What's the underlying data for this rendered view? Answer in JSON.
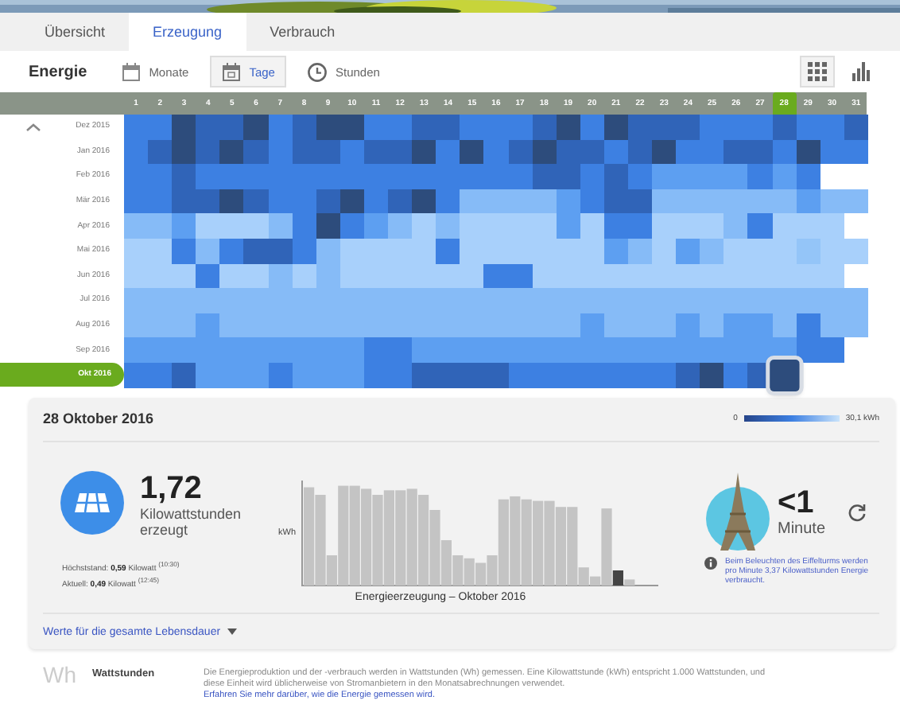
{
  "tabs": [
    {
      "label": "Übersicht",
      "selected": false
    },
    {
      "label": "Erzeugung",
      "selected": true
    },
    {
      "label": "Verbrauch",
      "selected": false
    }
  ],
  "toolbar": {
    "title": "Energie",
    "periods": [
      {
        "label": "Monate",
        "kind": "month",
        "selected": false
      },
      {
        "label": "Tage",
        "kind": "day",
        "selected": true
      },
      {
        "label": "Stunden",
        "kind": "hour",
        "selected": false
      }
    ],
    "views": [
      {
        "kind": "grid",
        "selected": true
      },
      {
        "kind": "bars",
        "selected": false
      }
    ]
  },
  "heatmap": {
    "days": [
      {
        "label": "1",
        "selected": false
      },
      {
        "label": "2",
        "selected": false
      },
      {
        "label": "3",
        "selected": false
      },
      {
        "label": "4",
        "selected": false
      },
      {
        "label": "5",
        "selected": false
      },
      {
        "label": "6",
        "selected": false
      },
      {
        "label": "7",
        "selected": false
      },
      {
        "label": "8",
        "selected": false
      },
      {
        "label": "9",
        "selected": false
      },
      {
        "label": "10",
        "selected": false
      },
      {
        "label": "11",
        "selected": false
      },
      {
        "label": "12",
        "selected": false
      },
      {
        "label": "13",
        "selected": false
      },
      {
        "label": "14",
        "selected": false
      },
      {
        "label": "15",
        "selected": false
      },
      {
        "label": "16",
        "selected": false
      },
      {
        "label": "17",
        "selected": false
      },
      {
        "label": "18",
        "selected": false
      },
      {
        "label": "19",
        "selected": false
      },
      {
        "label": "20",
        "selected": false
      },
      {
        "label": "21",
        "selected": false
      },
      {
        "label": "22",
        "selected": false
      },
      {
        "label": "23",
        "selected": false
      },
      {
        "label": "24",
        "selected": false
      },
      {
        "label": "25",
        "selected": false
      },
      {
        "label": "26",
        "selected": false
      },
      {
        "label": "27",
        "selected": false
      },
      {
        "label": "28",
        "selected": true
      },
      {
        "label": "29",
        "selected": false
      },
      {
        "label": "30",
        "selected": false
      },
      {
        "label": "31",
        "selected": false
      }
    ],
    "months": [
      {
        "label": "Dez 2015",
        "selected": false,
        "cells": [
          {
            "color": "#3d80e2"
          },
          {
            "color": "#3d80e2"
          },
          {
            "color": "#2d4c7c"
          },
          {
            "color": "#3064b8"
          },
          {
            "color": "#3064b8"
          },
          {
            "color": "#2d4c7c"
          },
          {
            "color": "#3d80e2"
          },
          {
            "color": "#3064b8"
          },
          {
            "color": "#2d4c7c"
          },
          {
            "color": "#2d4c7c"
          },
          {
            "color": "#3d80e2"
          },
          {
            "color": "#3d80e2"
          },
          {
            "color": "#3064b8"
          },
          {
            "color": "#3064b8"
          },
          {
            "color": "#3d80e2"
          },
          {
            "color": "#3d80e2"
          },
          {
            "color": "#3d80e2"
          },
          {
            "color": "#3064b8"
          },
          {
            "color": "#2d4c7c"
          },
          {
            "color": "#3d80e2"
          },
          {
            "color": "#2d4c7c"
          },
          {
            "color": "#3064b8"
          },
          {
            "color": "#3064b8"
          },
          {
            "color": "#3064b8"
          },
          {
            "color": "#3d80e2"
          },
          {
            "color": "#3d80e2"
          },
          {
            "color": "#3d80e2"
          },
          {
            "color": "#3064b8"
          },
          {
            "color": "#3d80e2"
          },
          {
            "color": "#3d80e2"
          },
          {
            "color": "#3064b8"
          }
        ]
      },
      {
        "label": "Jan 2016",
        "selected": false,
        "cells": [
          {
            "color": "#3d80e2"
          },
          {
            "color": "#3064b8"
          },
          {
            "color": "#2d4c7c"
          },
          {
            "color": "#3064b8"
          },
          {
            "color": "#2d4c7c"
          },
          {
            "color": "#3064b8"
          },
          {
            "color": "#3d80e2"
          },
          {
            "color": "#3064b8"
          },
          {
            "color": "#3064b8"
          },
          {
            "color": "#3d80e2"
          },
          {
            "color": "#3064b8"
          },
          {
            "color": "#3064b8"
          },
          {
            "color": "#2d4c7c"
          },
          {
            "color": "#3d80e2"
          },
          {
            "color": "#2d4c7c"
          },
          {
            "color": "#3d80e2"
          },
          {
            "color": "#3064b8"
          },
          {
            "color": "#2d4c7c"
          },
          {
            "color": "#3064b8"
          },
          {
            "color": "#3064b8"
          },
          {
            "color": "#3d80e2"
          },
          {
            "color": "#3064b8"
          },
          {
            "color": "#2d4c7c"
          },
          {
            "color": "#3d80e2"
          },
          {
            "color": "#3d80e2"
          },
          {
            "color": "#3064b8"
          },
          {
            "color": "#3064b8"
          },
          {
            "color": "#3d80e2"
          },
          {
            "color": "#2d4c7c"
          },
          {
            "color": "#3d80e2"
          },
          {
            "color": "#3d80e2"
          }
        ]
      },
      {
        "label": "Feb 2016",
        "selected": false,
        "cells": [
          {
            "color": "#3d80e2"
          },
          {
            "color": "#3d80e2"
          },
          {
            "color": "#3064b8"
          },
          {
            "color": "#3d80e2"
          },
          {
            "color": "#3d80e2"
          },
          {
            "color": "#3d80e2"
          },
          {
            "color": "#3d80e2"
          },
          {
            "color": "#3d80e2"
          },
          {
            "color": "#3d80e2"
          },
          {
            "color": "#3d80e2"
          },
          {
            "color": "#3d80e2"
          },
          {
            "color": "#3d80e2"
          },
          {
            "color": "#3d80e2"
          },
          {
            "color": "#3d80e2"
          },
          {
            "color": "#3d80e2"
          },
          {
            "color": "#3d80e2"
          },
          {
            "color": "#3d80e2"
          },
          {
            "color": "#3064b8"
          },
          {
            "color": "#3064b8"
          },
          {
            "color": "#3d80e2"
          },
          {
            "color": "#3064b8"
          },
          {
            "color": "#3d80e2"
          },
          {
            "color": "#5d9ff1"
          },
          {
            "color": "#5d9ff1"
          },
          {
            "color": "#5d9ff1"
          },
          {
            "color": "#5d9ff1"
          },
          {
            "color": "#3d80e2"
          },
          {
            "color": "#5d9ff1"
          },
          {
            "color": "#3d80e2"
          }
        ]
      },
      {
        "label": "Mär 2016",
        "selected": false,
        "cells": [
          {
            "color": "#3d80e2"
          },
          {
            "color": "#3d80e2"
          },
          {
            "color": "#3064b8"
          },
          {
            "color": "#3064b8"
          },
          {
            "color": "#2d4c7c"
          },
          {
            "color": "#3064b8"
          },
          {
            "color": "#3d80e2"
          },
          {
            "color": "#3d80e2"
          },
          {
            "color": "#3064b8"
          },
          {
            "color": "#2d4c7c"
          },
          {
            "color": "#3d80e2"
          },
          {
            "color": "#3064b8"
          },
          {
            "color": "#2d4c7c"
          },
          {
            "color": "#3d80e2"
          },
          {
            "color": "#86bbf7"
          },
          {
            "color": "#86bbf7"
          },
          {
            "color": "#86bbf7"
          },
          {
            "color": "#86bbf7"
          },
          {
            "color": "#5d9ff1"
          },
          {
            "color": "#3d80e2"
          },
          {
            "color": "#3064b8"
          },
          {
            "color": "#3064b8"
          },
          {
            "color": "#86bbf7"
          },
          {
            "color": "#86bbf7"
          },
          {
            "color": "#86bbf7"
          },
          {
            "color": "#86bbf7"
          },
          {
            "color": "#86bbf7"
          },
          {
            "color": "#86bbf7"
          },
          {
            "color": "#5d9ff1"
          },
          {
            "color": "#86bbf7"
          },
          {
            "color": "#86bbf7"
          }
        ]
      },
      {
        "label": "Apr 2016",
        "selected": false,
        "cells": [
          {
            "color": "#86bbf7"
          },
          {
            "color": "#86bbf7"
          },
          {
            "color": "#5d9ff1"
          },
          {
            "color": "#a8d0fb"
          },
          {
            "color": "#a8d0fb"
          },
          {
            "color": "#a8d0fb"
          },
          {
            "color": "#86bbf7"
          },
          {
            "color": "#3d80e2"
          },
          {
            "color": "#2d4c7c"
          },
          {
            "color": "#3d80e2"
          },
          {
            "color": "#5d9ff1"
          },
          {
            "color": "#86bbf7"
          },
          {
            "color": "#a8d0fb"
          },
          {
            "color": "#86bbf7"
          },
          {
            "color": "#a8d0fb"
          },
          {
            "color": "#a8d0fb"
          },
          {
            "color": "#a8d0fb"
          },
          {
            "color": "#a8d0fb"
          },
          {
            "color": "#5d9ff1"
          },
          {
            "color": "#a8d0fb"
          },
          {
            "color": "#3d80e2"
          },
          {
            "color": "#3d80e2"
          },
          {
            "color": "#a8d0fb"
          },
          {
            "color": "#a8d0fb"
          },
          {
            "color": "#a8d0fb"
          },
          {
            "color": "#86bbf7"
          },
          {
            "color": "#3d80e2"
          },
          {
            "color": "#a8d0fb"
          },
          {
            "color": "#a8d0fb"
          },
          {
            "color": "#a8d0fb"
          }
        ]
      },
      {
        "label": "Mai 2016",
        "selected": false,
        "cells": [
          {
            "color": "#a8d0fb"
          },
          {
            "color": "#a8d0fb"
          },
          {
            "color": "#3d80e2"
          },
          {
            "color": "#86bbf7"
          },
          {
            "color": "#3d80e2"
          },
          {
            "color": "#3064b8"
          },
          {
            "color": "#3064b8"
          },
          {
            "color": "#3d80e2"
          },
          {
            "color": "#86bbf7"
          },
          {
            "color": "#a8d0fb"
          },
          {
            "color": "#a8d0fb"
          },
          {
            "color": "#a8d0fb"
          },
          {
            "color": "#a8d0fb"
          },
          {
            "color": "#3d80e2"
          },
          {
            "color": "#a8d0fb"
          },
          {
            "color": "#a8d0fb"
          },
          {
            "color": "#a8d0fb"
          },
          {
            "color": "#a8d0fb"
          },
          {
            "color": "#a8d0fb"
          },
          {
            "color": "#a8d0fb"
          },
          {
            "color": "#5d9ff1"
          },
          {
            "color": "#86bbf7"
          },
          {
            "color": "#a8d0fb"
          },
          {
            "color": "#5d9ff1"
          },
          {
            "color": "#86bbf7"
          },
          {
            "color": "#a8d0fb"
          },
          {
            "color": "#a8d0fb"
          },
          {
            "color": "#a8d0fb"
          },
          {
            "color": "#94c5f8"
          },
          {
            "color": "#a8d0fb"
          },
          {
            "color": "#a8d0fb"
          }
        ]
      },
      {
        "label": "Jun 2016",
        "selected": false,
        "cells": [
          {
            "color": "#a8d0fb"
          },
          {
            "color": "#a8d0fb"
          },
          {
            "color": "#a8d0fb"
          },
          {
            "color": "#3d80e2"
          },
          {
            "color": "#a8d0fb"
          },
          {
            "color": "#a8d0fb"
          },
          {
            "color": "#86bbf7"
          },
          {
            "color": "#a8d0fb"
          },
          {
            "color": "#86bbf7"
          },
          {
            "color": "#a8d0fb"
          },
          {
            "color": "#a8d0fb"
          },
          {
            "color": "#a8d0fb"
          },
          {
            "color": "#a8d0fb"
          },
          {
            "color": "#a8d0fb"
          },
          {
            "color": "#a8d0fb"
          },
          {
            "color": "#3d80e2"
          },
          {
            "color": "#3d80e2"
          },
          {
            "color": "#a8d0fb"
          },
          {
            "color": "#a8d0fb"
          },
          {
            "color": "#a8d0fb"
          },
          {
            "color": "#a8d0fb"
          },
          {
            "color": "#a8d0fb"
          },
          {
            "color": "#a8d0fb"
          },
          {
            "color": "#a8d0fb"
          },
          {
            "color": "#a8d0fb"
          },
          {
            "color": "#a8d0fb"
          },
          {
            "color": "#a8d0fb"
          },
          {
            "color": "#a8d0fb"
          },
          {
            "color": "#a8d0fb"
          },
          {
            "color": "#a8d0fb"
          }
        ]
      },
      {
        "label": "Jul 2016",
        "selected": false,
        "cells": [
          {
            "color": "#86bbf7"
          },
          {
            "color": "#86bbf7"
          },
          {
            "color": "#86bbf7"
          },
          {
            "color": "#86bbf7"
          },
          {
            "color": "#86bbf7"
          },
          {
            "color": "#86bbf7"
          },
          {
            "color": "#86bbf7"
          },
          {
            "color": "#86bbf7"
          },
          {
            "color": "#86bbf7"
          },
          {
            "color": "#86bbf7"
          },
          {
            "color": "#86bbf7"
          },
          {
            "color": "#86bbf7"
          },
          {
            "color": "#86bbf7"
          },
          {
            "color": "#86bbf7"
          },
          {
            "color": "#86bbf7"
          },
          {
            "color": "#86bbf7"
          },
          {
            "color": "#86bbf7"
          },
          {
            "color": "#86bbf7"
          },
          {
            "color": "#86bbf7"
          },
          {
            "color": "#86bbf7"
          },
          {
            "color": "#86bbf7"
          },
          {
            "color": "#86bbf7"
          },
          {
            "color": "#86bbf7"
          },
          {
            "color": "#86bbf7"
          },
          {
            "color": "#86bbf7"
          },
          {
            "color": "#86bbf7"
          },
          {
            "color": "#86bbf7"
          },
          {
            "color": "#86bbf7"
          },
          {
            "color": "#86bbf7"
          },
          {
            "color": "#86bbf7"
          },
          {
            "color": "#86bbf7"
          }
        ]
      },
      {
        "label": "Aug 2016",
        "selected": false,
        "cells": [
          {
            "color": "#86bbf7"
          },
          {
            "color": "#86bbf7"
          },
          {
            "color": "#86bbf7"
          },
          {
            "color": "#5d9ff1"
          },
          {
            "color": "#86bbf7"
          },
          {
            "color": "#86bbf7"
          },
          {
            "color": "#86bbf7"
          },
          {
            "color": "#86bbf7"
          },
          {
            "color": "#86bbf7"
          },
          {
            "color": "#86bbf7"
          },
          {
            "color": "#86bbf7"
          },
          {
            "color": "#86bbf7"
          },
          {
            "color": "#86bbf7"
          },
          {
            "color": "#86bbf7"
          },
          {
            "color": "#86bbf7"
          },
          {
            "color": "#86bbf7"
          },
          {
            "color": "#86bbf7"
          },
          {
            "color": "#86bbf7"
          },
          {
            "color": "#86bbf7"
          },
          {
            "color": "#5d9ff1"
          },
          {
            "color": "#86bbf7"
          },
          {
            "color": "#86bbf7"
          },
          {
            "color": "#86bbf7"
          },
          {
            "color": "#5d9ff1"
          },
          {
            "color": "#86bbf7"
          },
          {
            "color": "#5d9ff1"
          },
          {
            "color": "#5d9ff1"
          },
          {
            "color": "#86bbf7"
          },
          {
            "color": "#3d80e2"
          },
          {
            "color": "#86bbf7"
          },
          {
            "color": "#86bbf7"
          }
        ]
      },
      {
        "label": "Sep 2016",
        "selected": false,
        "cells": [
          {
            "color": "#5d9ff1"
          },
          {
            "color": "#5d9ff1"
          },
          {
            "color": "#5d9ff1"
          },
          {
            "color": "#5d9ff1"
          },
          {
            "color": "#5d9ff1"
          },
          {
            "color": "#5d9ff1"
          },
          {
            "color": "#5d9ff1"
          },
          {
            "color": "#5d9ff1"
          },
          {
            "color": "#5d9ff1"
          },
          {
            "color": "#5d9ff1"
          },
          {
            "color": "#3d80e2"
          },
          {
            "color": "#3d80e2"
          },
          {
            "color": "#5d9ff1"
          },
          {
            "color": "#5d9ff1"
          },
          {
            "color": "#5d9ff1"
          },
          {
            "color": "#5d9ff1"
          },
          {
            "color": "#5d9ff1"
          },
          {
            "color": "#5d9ff1"
          },
          {
            "color": "#5d9ff1"
          },
          {
            "color": "#5d9ff1"
          },
          {
            "color": "#5d9ff1"
          },
          {
            "color": "#5d9ff1"
          },
          {
            "color": "#5d9ff1"
          },
          {
            "color": "#5d9ff1"
          },
          {
            "color": "#5d9ff1"
          },
          {
            "color": "#5d9ff1"
          },
          {
            "color": "#5d9ff1"
          },
          {
            "color": "#5d9ff1"
          },
          {
            "color": "#3d80e2"
          },
          {
            "color": "#3d80e2"
          }
        ]
      },
      {
        "label": "Okt 2016",
        "selected": true,
        "cells": [
          {
            "color": "#3d80e2"
          },
          {
            "color": "#3d80e2"
          },
          {
            "color": "#3064b8"
          },
          {
            "color": "#5d9ff1"
          },
          {
            "color": "#5d9ff1"
          },
          {
            "color": "#5d9ff1"
          },
          {
            "color": "#3d80e2"
          },
          {
            "color": "#5d9ff1"
          },
          {
            "color": "#5d9ff1"
          },
          {
            "color": "#5d9ff1"
          },
          {
            "color": "#3d80e2"
          },
          {
            "color": "#3d80e2"
          },
          {
            "color": "#3064b8"
          },
          {
            "color": "#3064b8"
          },
          {
            "color": "#3064b8"
          },
          {
            "color": "#3064b8"
          },
          {
            "color": "#3d80e2"
          },
          {
            "color": "#3d80e2"
          },
          {
            "color": "#3d80e2"
          },
          {
            "color": "#3d80e2"
          },
          {
            "color": "#3d80e2"
          },
          {
            "color": "#3d80e2"
          },
          {
            "color": "#3d80e2"
          },
          {
            "color": "#3064b8"
          },
          {
            "color": "#2d4c7c"
          },
          {
            "color": "#3d80e2"
          },
          {
            "color": "#3064b8"
          },
          {
            "color": "#2d4c7c"
          }
        ]
      }
    ]
  },
  "detail": {
    "date": "28 Oktober 2016",
    "legend": {
      "min": "0",
      "max": "30,1 kWh"
    },
    "production": {
      "value": "1,72",
      "unit": "Kilowattstunden erzeugt",
      "peak": "Höchststand: **0,59** Kilowatt $^{(10:30)}$",
      "current": "Aktuell: **0,49** Kilowatt $^{(12:45)}$"
    },
    "production_chart": {
      "ylabel": "kWh",
      "title": "Energieerzeugung – Oktober 2016"
    },
    "comparison": {
      "value": "<1",
      "unit": "Minute",
      "note": "Beim Beleuchten des Eiffelturms werden pro Minute 3,37 Kilowattstunden Energie verbraucht."
    },
    "lifetime_link": "Werte für die gesamte Lebensdauer"
  },
  "footer": {
    "symbol": "Wh",
    "title": "Wattstunden",
    "text": "Die Energieproduktion und der -verbrauch werden in Wattstunden (Wh) gemessen. Eine Kilowattstunde (kWh) entspricht 1.000 Wattstunden, und diese Einheit wird üblicherweise von Stromanbietern in den Monatsabrechnungen verwendet.",
    "link": "Erfahren Sie mehr darüber, wie die Energie gemessen wird."
  }
}
